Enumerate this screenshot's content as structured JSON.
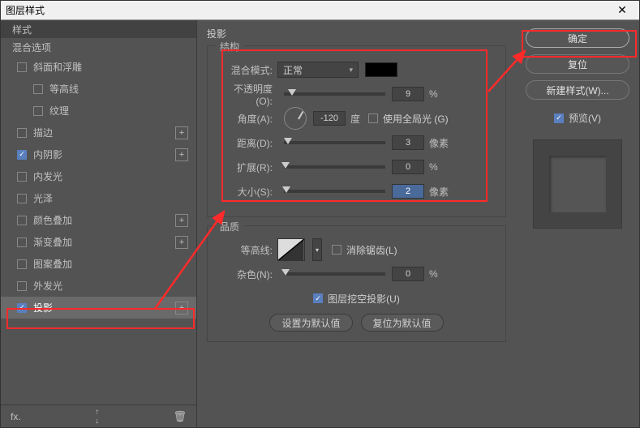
{
  "titlebar": {
    "title": "图层样式",
    "close": "✕"
  },
  "left": {
    "header": "样式",
    "sub": "混合选项",
    "items": [
      {
        "label": "斜面和浮雕",
        "checked": false,
        "indent": false,
        "plus": false
      },
      {
        "label": "等高线",
        "checked": false,
        "indent": true,
        "plus": false
      },
      {
        "label": "纹理",
        "checked": false,
        "indent": true,
        "plus": false
      },
      {
        "label": "描边",
        "checked": false,
        "indent": false,
        "plus": true
      },
      {
        "label": "内阴影",
        "checked": true,
        "indent": false,
        "plus": true
      },
      {
        "label": "内发光",
        "checked": false,
        "indent": false,
        "plus": false
      },
      {
        "label": "光泽",
        "checked": false,
        "indent": false,
        "plus": false
      },
      {
        "label": "颜色叠加",
        "checked": false,
        "indent": false,
        "plus": true
      },
      {
        "label": "渐变叠加",
        "checked": false,
        "indent": false,
        "plus": true
      },
      {
        "label": "图案叠加",
        "checked": false,
        "indent": false,
        "plus": false
      },
      {
        "label": "外发光",
        "checked": false,
        "indent": false,
        "plus": false
      },
      {
        "label": "投影",
        "checked": true,
        "indent": false,
        "plus": true,
        "selected": true
      }
    ]
  },
  "mid": {
    "panel_title": "投影",
    "structure_legend": "结构",
    "blend_mode_label": "混合模式:",
    "blend_mode_value": "正常",
    "opacity_label": "不透明度(O):",
    "opacity_value": "9",
    "opacity_unit": "%",
    "angle_label": "角度(A):",
    "angle_value": "-120",
    "angle_unit": "度",
    "global_light_label": "使用全局光 (G)",
    "distance_label": "距离(D):",
    "distance_value": "3",
    "distance_unit": "像素",
    "spread_label": "扩展(R):",
    "spread_value": "0",
    "spread_unit": "%",
    "size_label": "大小(S):",
    "size_value": "2",
    "size_unit": "像素",
    "quality_legend": "品质",
    "contour_label": "等高线:",
    "antialias_label": "消除锯齿(L)",
    "noise_label": "杂色(N):",
    "noise_value": "0",
    "noise_unit": "%",
    "knockout_label": "图层挖空投影(U)",
    "set_default": "设置为默认值",
    "reset_default": "复位为默认值"
  },
  "right": {
    "ok": "确定",
    "cancel": "复位",
    "new_style": "新建样式(W)...",
    "preview": "预览(V)"
  }
}
